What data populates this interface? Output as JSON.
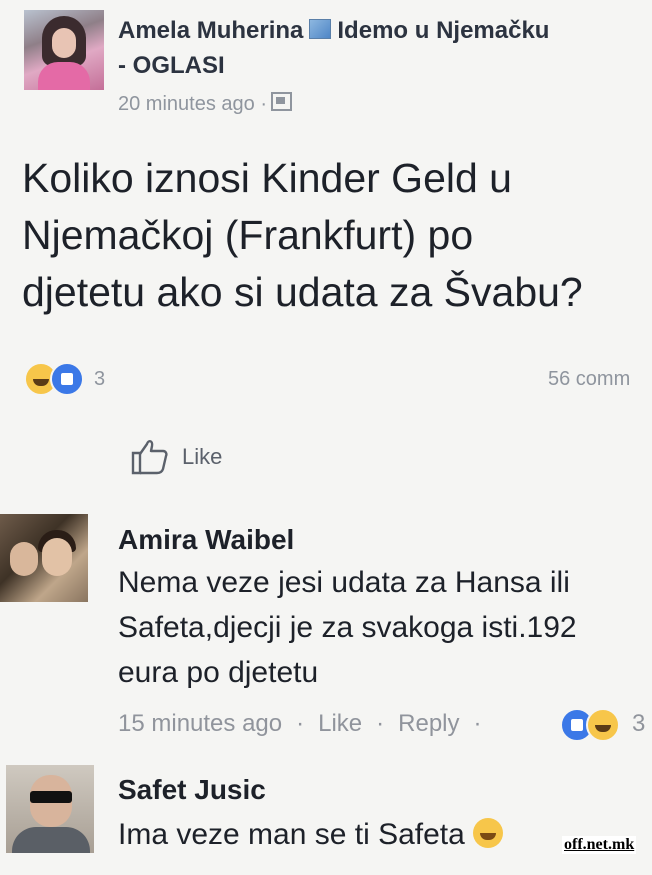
{
  "post": {
    "author": "Amela Muherina",
    "group_name": "Idemo u Njemačku",
    "group_name_cont": "- OGLASI",
    "timestamp": "20 minutes ago ·",
    "text_lines": [
      "Koliko iznosi Kinder Geld u",
      "Njemačkoj (Frankfurt) po",
      "djetetu ako si udata za Švabu?"
    ],
    "reaction_count": "3",
    "comment_count": "56 comm",
    "like_label": "Like"
  },
  "comments": [
    {
      "name": "Amira Waibel",
      "text_lines": [
        "Nema veze jesi udata za Hansa ili",
        "Safeta,djecji je za svakoga isti.192",
        "eura po djetetu"
      ],
      "timestamp": "15 minutes ago",
      "like_label": "Like",
      "reply_label": "Reply",
      "reaction_count": "3"
    },
    {
      "name": "Safet Jusic",
      "text": "Ima veze man se ti Safeta"
    }
  ],
  "watermark": "off.net.mk",
  "colors": {
    "like_blue": "#3b78e7",
    "haha_yellow": "#f7c64a",
    "meta_gray": "#90949c"
  },
  "icons": [
    "group-icon",
    "globe-icon",
    "thumbs-up-icon",
    "haha-reaction-icon",
    "like-reaction-icon",
    "smile-emoji-icon"
  ]
}
